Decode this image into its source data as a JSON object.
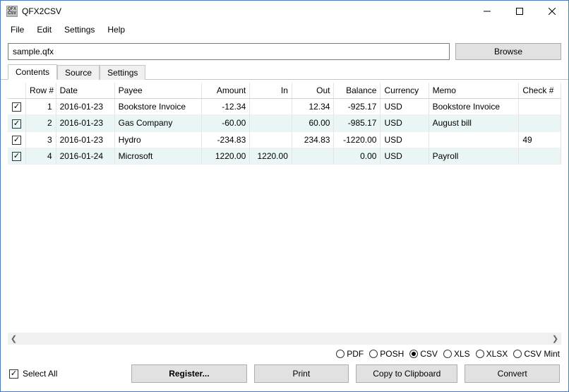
{
  "app": {
    "title": "QFX2CSV",
    "icon_text": "QFX\nCSV"
  },
  "menu": {
    "file": "File",
    "edit": "Edit",
    "settings": "Settings",
    "help": "Help"
  },
  "filebar": {
    "value": "sample.qfx",
    "browse": "Browse"
  },
  "tabs": {
    "contents": "Contents",
    "source": "Source",
    "settings": "Settings"
  },
  "headers": {
    "row": "Row #",
    "date": "Date",
    "payee": "Payee",
    "amount": "Amount",
    "in": "In",
    "out": "Out",
    "balance": "Balance",
    "currency": "Currency",
    "memo": "Memo",
    "check": "Check #"
  },
  "rows": [
    {
      "checked": true,
      "row": "1",
      "date": "2016-01-23",
      "payee": "Bookstore Invoice",
      "amount": "-12.34",
      "in": "",
      "out": "12.34",
      "balance": "-925.17",
      "currency": "USD",
      "memo": "Bookstore Invoice",
      "check": ""
    },
    {
      "checked": true,
      "row": "2",
      "date": "2016-01-23",
      "payee": "Gas Company",
      "amount": "-60.00",
      "in": "",
      "out": "60.00",
      "balance": "-985.17",
      "currency": "USD",
      "memo": "August bill",
      "check": ""
    },
    {
      "checked": true,
      "row": "3",
      "date": "2016-01-23",
      "payee": "Hydro",
      "amount": "-234.83",
      "in": "",
      "out": "234.83",
      "balance": "-1220.00",
      "currency": "USD",
      "memo": "",
      "check": "49"
    },
    {
      "checked": true,
      "row": "4",
      "date": "2016-01-24",
      "payee": "Microsoft",
      "amount": "1220.00",
      "in": "1220.00",
      "out": "",
      "balance": "0.00",
      "currency": "USD",
      "memo": "Payroll",
      "check": ""
    }
  ],
  "formats": {
    "pdf": "PDF",
    "posh": "POSH",
    "csv": "CSV",
    "xls": "XLS",
    "xlsx": "XLSX",
    "csvmint": "CSV Mint",
    "selected": "csv"
  },
  "bottom": {
    "select_all": "Select All",
    "register": "Register...",
    "print": "Print",
    "copy": "Copy to Clipboard",
    "convert": "Convert"
  }
}
